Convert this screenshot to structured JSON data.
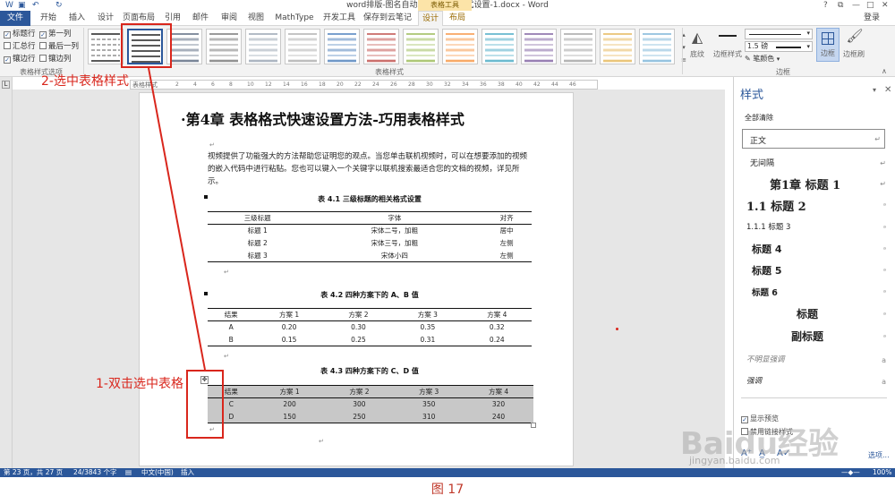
{
  "titlebar": {
    "title": "word排版-图名自动编号及图名格式设置-1.docx - Word",
    "context_group": "表格工具",
    "help": "?",
    "restore": "⧉",
    "minimize": "—",
    "maximize": "□",
    "close": "✕"
  },
  "tabs": [
    {
      "label": "文件"
    },
    {
      "label": "开始"
    },
    {
      "label": "插入"
    },
    {
      "label": "设计"
    },
    {
      "label": "页面布局"
    },
    {
      "label": "引用"
    },
    {
      "label": "邮件"
    },
    {
      "label": "审阅"
    },
    {
      "label": "视图"
    },
    {
      "label": "MathType"
    },
    {
      "label": "开发工具"
    },
    {
      "label": "保存到云笔记"
    },
    {
      "label": "设计"
    },
    {
      "label": "布局"
    }
  ],
  "signin": "登录",
  "ribbon": {
    "style_options": [
      "标题行",
      "第一列",
      "汇总行",
      "最后一列",
      "镶边行",
      "镶边列"
    ],
    "style_options_checked": [
      true,
      true,
      false,
      false,
      true,
      false
    ],
    "group_style_options": "表格样式选项",
    "group_table_styles": "表格样式",
    "shading": "底纹",
    "border_styles": "边框样式",
    "pen_weight": "1.5 磅",
    "pen_color": "笔颜色",
    "borders": "边框",
    "border_painter": "边框刷",
    "group_borders": "边框"
  },
  "ruler": {
    "label": "表格样式",
    "ticks": [
      "2",
      "4",
      "6",
      "8",
      "10",
      "12",
      "14",
      "16",
      "18",
      "20",
      "22",
      "24",
      "26",
      "28",
      "30",
      "32",
      "34",
      "36",
      "38",
      "40",
      "42",
      "44",
      "46"
    ]
  },
  "document": {
    "chapter_title": "·第4章  表格格式快速设置方法-巧用表格样式",
    "paragraph": "视频提供了功能强大的方法帮助您证明您的观点。当您单击联机视频时，可以在想要添加的视频的嵌入代码中进行粘贴。您也可以键入一个关键字以联机搜索最适合您的文档的视频，详见所示。",
    "return_mark": "↵",
    "table1": {
      "caption": "表 4.1  三级标题的相关格式设置",
      "headers": [
        "三级标题",
        "字体",
        "对齐"
      ],
      "rows": [
        [
          "标题 1",
          "宋体二号，加粗",
          "居中"
        ],
        [
          "标题 2",
          "宋体三号，加粗",
          "左侧"
        ],
        [
          "标题 3",
          "宋体小四",
          "左侧"
        ]
      ]
    },
    "table2": {
      "caption": "表 4.2  四种方案下的 A、B 值",
      "headers": [
        "结果",
        "方案 1",
        "方案 2",
        "方案 3",
        "方案 4"
      ],
      "rows": [
        [
          "A",
          "0.20",
          "0.30",
          "0.35",
          "0.32"
        ],
        [
          "B",
          "0.15",
          "0.25",
          "0.31",
          "0.24"
        ]
      ]
    },
    "table3": {
      "caption": "表 4.3 四种方案下的 C、D 值",
      "headers": [
        "结果",
        "方案 1",
        "方案 2",
        "方案 3",
        "方案 4"
      ],
      "rows": [
        [
          "C",
          "200",
          "300",
          "350",
          "320"
        ],
        [
          "D",
          "150",
          "250",
          "310",
          "240"
        ]
      ]
    }
  },
  "styles_pane": {
    "title": "样式",
    "clear_all": "全部清除",
    "items": [
      {
        "name": "正文",
        "icon": "↵"
      },
      {
        "name": "无间隔",
        "icon": "↵"
      },
      {
        "name": "第1章  标题 1",
        "icon": "↵"
      },
      {
        "name": "1.1  标题 2",
        "icon": "ᵃ"
      },
      {
        "name": "1.1.1  标题 3",
        "icon": "ᵃ"
      },
      {
        "name": "标题 4",
        "icon": "ᵃ"
      },
      {
        "name": "标题 5",
        "icon": "ᵃ"
      },
      {
        "name": "标题 6",
        "icon": "ᵃ"
      },
      {
        "name": "标题",
        "icon": "ᵃ"
      },
      {
        "name": "副标题",
        "icon": "ᵃ"
      },
      {
        "name": "不明显强调",
        "icon": "a"
      },
      {
        "name": "强调",
        "icon": "a"
      }
    ],
    "show_preview": "显示预览",
    "linked_styles": "禁用链接样式",
    "options": "选项..."
  },
  "status": {
    "page": "第 23 页，共 27 页",
    "words": "24/3843 个字",
    "language": "中文(中国)",
    "mode": "插入",
    "zoom": "100%"
  },
  "annotations": {
    "step2": "2-选中表格样式",
    "step1": "1-双击选中表格",
    "figure_caption": "图 17"
  },
  "watermark": "Baidu经验",
  "watermark_url": "jingyan.baidu.com",
  "colors": {
    "accent": "#2b579a",
    "annotation": "#d9261c",
    "table_fill": "#c8c8c8"
  }
}
